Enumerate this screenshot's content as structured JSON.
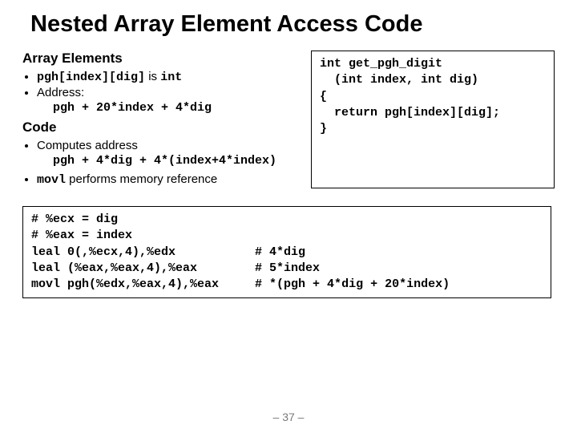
{
  "title": "Nested Array Element Access Code",
  "left": {
    "h1": "Array Elements",
    "b1_pre": "pgh[index][dig]",
    "b1_mid": " is ",
    "b1_post": "int",
    "b2": "Address:",
    "b2_sub": "pgh + 20*index + 4*dig",
    "h2": "Code",
    "c1": "Computes address",
    "c1_sub": "pgh + 4*dig + 4*(index+4*index)",
    "c2_pre": "movl",
    "c2_post": " performs memory reference"
  },
  "cfunc": "int get_pgh_digit\n  (int index, int dig)\n{\n  return pgh[index][dig];\n}",
  "asm": "# %ecx = dig\n# %eax = index\nleal 0(,%ecx,4),%edx           # 4*dig\nleal (%eax,%eax,4),%eax        # 5*index\nmovl pgh(%edx,%eax,4),%eax     # *(pgh + 4*dig + 20*index)",
  "pagenum": "– 37 –"
}
